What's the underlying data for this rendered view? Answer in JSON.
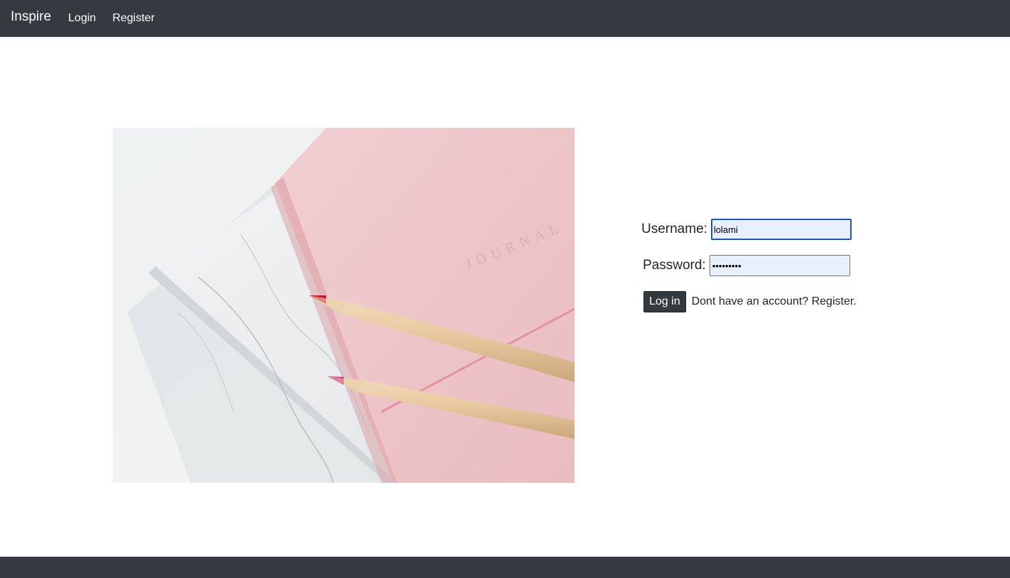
{
  "navbar": {
    "brand": "Inspire",
    "links": [
      "Login",
      "Register"
    ]
  },
  "hero": {
    "icon": "journal-pencils-photo",
    "embossed_text": "JOURNAL"
  },
  "login_form": {
    "username_label": "Username:",
    "username_value": "lolami",
    "password_label": "Password:",
    "password_value": "•••••••••",
    "submit_label": "Log in",
    "register_hint": "Dont have an account? Register."
  },
  "colors": {
    "navbar_bg": "#343a40",
    "input_autofill_bg": "#e8f0fe",
    "focus_ring": "#1a56c4"
  }
}
